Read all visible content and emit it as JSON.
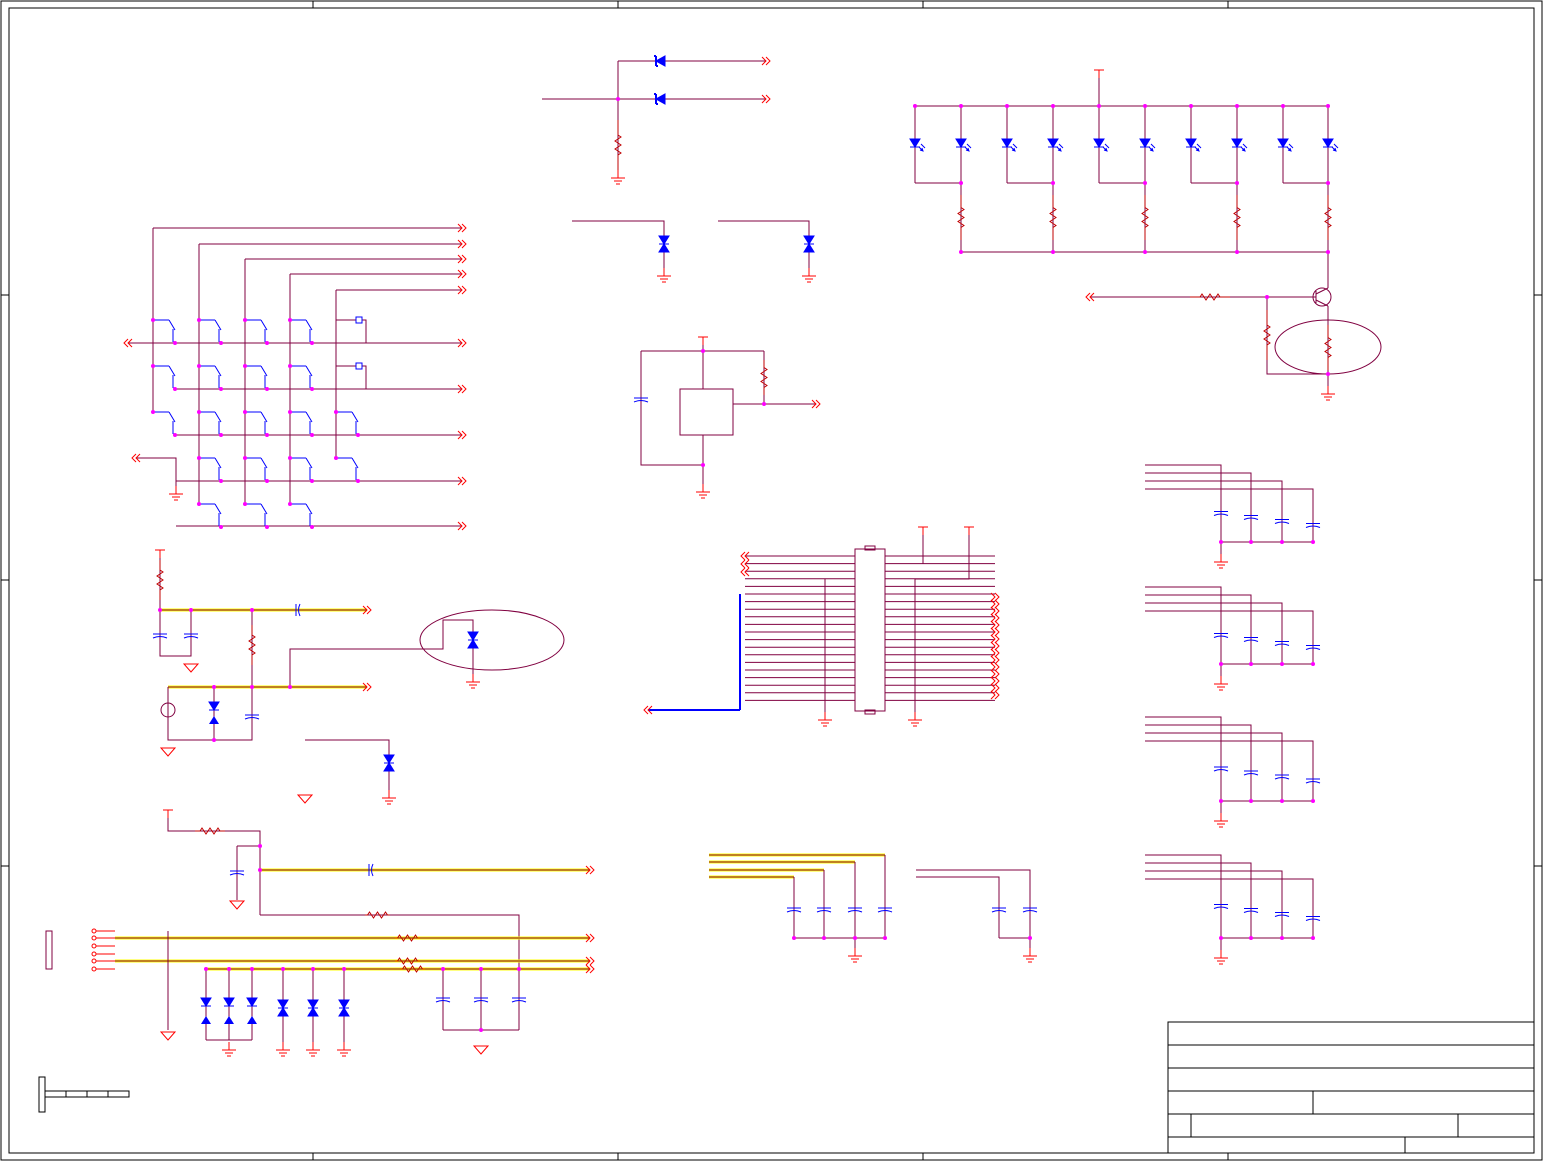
{
  "schematic": {
    "colors": {
      "wire": "#800040",
      "component": "#c00000",
      "diode": "#0000ff",
      "junction": "#ff00ff",
      "power": "#ff0000",
      "bus": "#0000ff",
      "highlight": "#ffff00",
      "frame": "#000000"
    },
    "title_block": {
      "rows": [
        "",
        "",
        "",
        "",
        ""
      ]
    }
  }
}
